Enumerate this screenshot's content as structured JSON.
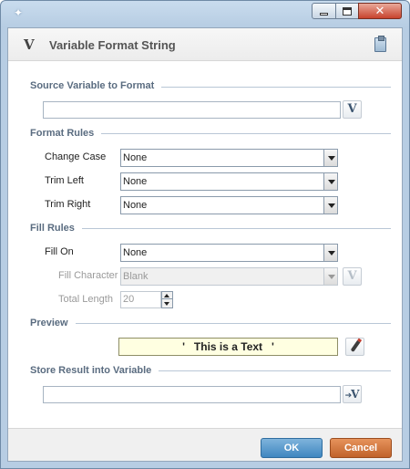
{
  "window": {
    "app_icon": "✦",
    "controls": {
      "minimize": "minimize",
      "maximize": "maximize",
      "close": "✕"
    }
  },
  "header": {
    "icon_letter": "V",
    "title": "Variable Format String",
    "clipboard_icon": "clipboard-icon"
  },
  "sections": {
    "source": "Source Variable to Format",
    "format_rules": "Format Rules",
    "fill_rules": "Fill Rules",
    "preview": "Preview",
    "store": "Store Result into Variable"
  },
  "source": {
    "value": "",
    "var_button": "V"
  },
  "format_rules": {
    "change_case": {
      "label": "Change Case",
      "value": "None"
    },
    "trim_left": {
      "label": "Trim Left",
      "value": "None"
    },
    "trim_right": {
      "label": "Trim Right",
      "value": "None"
    }
  },
  "fill_rules": {
    "fill_on": {
      "label": "Fill On",
      "value": "None"
    },
    "fill_character": {
      "label": "Fill Character",
      "value": "Blank",
      "var_button": "V"
    },
    "total_length": {
      "label": "Total Length",
      "value": "20"
    }
  },
  "preview": {
    "text": "'   This is a Text   '"
  },
  "store": {
    "value": "",
    "button": "V"
  },
  "footer": {
    "ok": "OK",
    "cancel": "Cancel"
  }
}
